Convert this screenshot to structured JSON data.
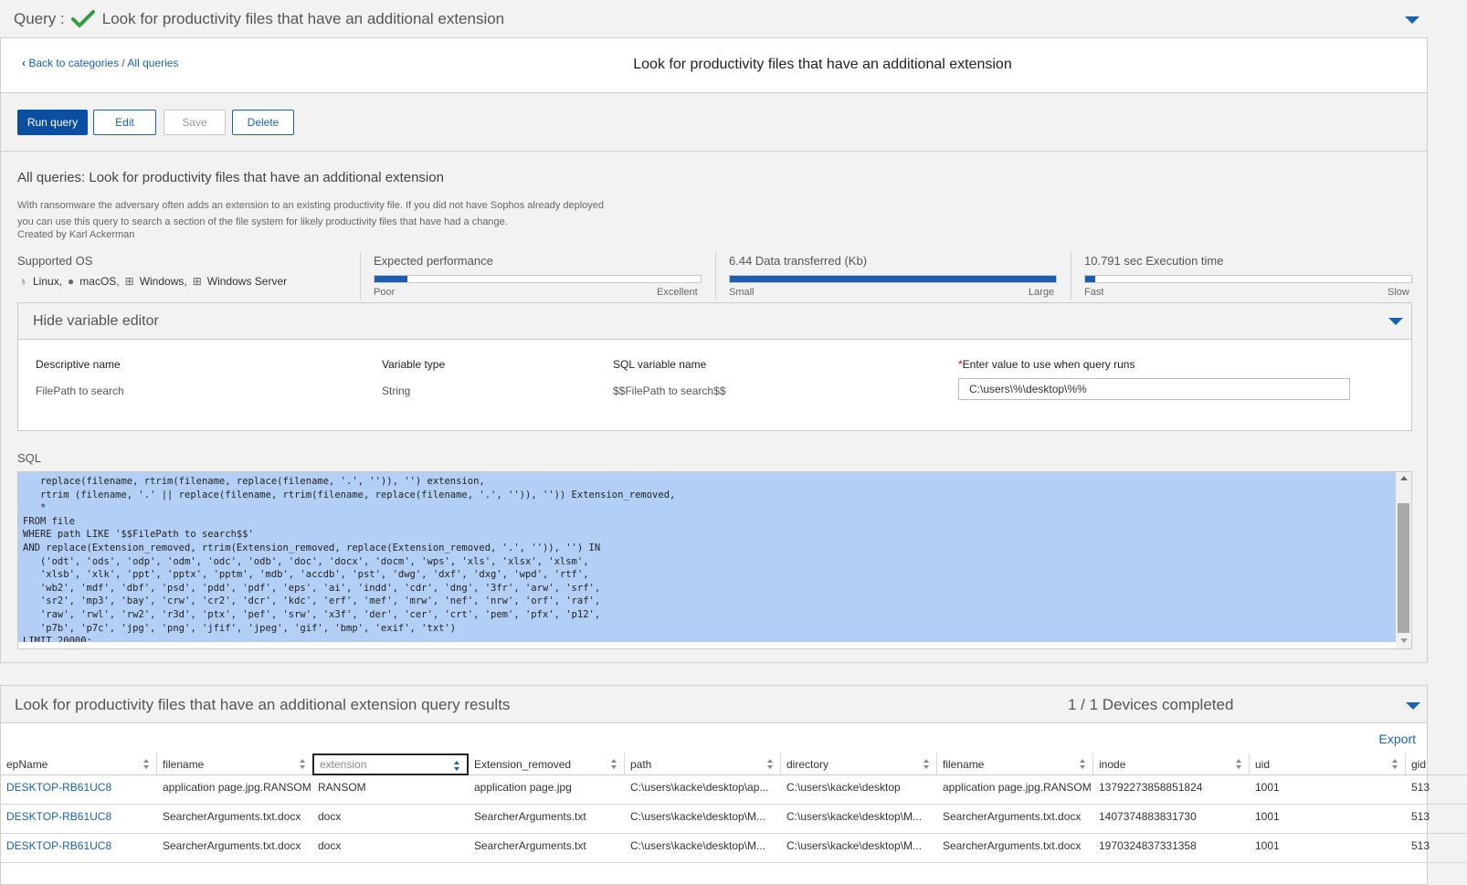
{
  "query_bar": {
    "prefix": "Query :",
    "title": "Look for productivity files that have an additional extension"
  },
  "breadcrumb": {
    "back": "Back to categories",
    "sep": " / ",
    "current": "All queries"
  },
  "header": {
    "title": "Look for productivity files that have an additional extension"
  },
  "toolbar": {
    "run": "Run query",
    "edit": "Edit",
    "save": "Save",
    "delete": "Delete"
  },
  "details": {
    "title": "All queries: Look for productivity files that have an additional extension",
    "description": "With ransomware the adversary often adds an extension to an existing productivity file. If you did not have Sophos already deployed you can use this query to search a section of the file system for likely productivity files that have had a change.",
    "author": "Created by Karl Ackerman"
  },
  "supported_os": {
    "label": "Supported OS",
    "items": [
      "Linux,",
      "macOS,",
      "Windows,",
      "Windows Server"
    ]
  },
  "metrics": {
    "performance": {
      "label": "Expected performance",
      "low": "Poor",
      "high": "Excellent",
      "fraction": 0.1
    },
    "data": {
      "label": "6.44 Data transferred (Kb)",
      "low": "Small",
      "high": "Large",
      "fraction": 1.0
    },
    "time": {
      "label": "10.791 sec Execution time",
      "low": "Fast",
      "high": "Slow",
      "fraction": 0.03
    }
  },
  "variable_editor": {
    "toggle": "Hide variable editor",
    "headers": {
      "name": "Descriptive name",
      "type": "Variable type",
      "sql": "SQL variable name",
      "value_req": "*",
      "value": "Enter value to use when query runs"
    },
    "row": {
      "name": "FilePath to search",
      "type": "String",
      "sql": "$$FilePath to search$$",
      "value": "C:\\users\\%\\desktop\\%%"
    }
  },
  "sql": {
    "label": "SQL",
    "lines": [
      "   replace(filename, rtrim(filename, replace(filename, '.', '')), '') extension,",
      "   rtrim (filename, '.' || replace(filename, rtrim(filename, replace(filename, '.', '')), '')) Extension_removed,",
      "   *",
      "FROM file",
      "WHERE path LIKE '$$FilePath to search$$'",
      "AND replace(Extension_removed, rtrim(Extension_removed, replace(Extension_removed, '.', '')), '') IN",
      "   ('odt', 'ods', 'odp', 'odm', 'odc', 'odb', 'doc', 'docx', 'docm', 'wps', 'xls', 'xlsx', 'xlsm',",
      "   'xlsb', 'xlk', 'ppt', 'pptx', 'pptm', 'mdb', 'accdb', 'pst', 'dwg', 'dxf', 'dxg', 'wpd', 'rtf',",
      "   'wb2', 'mdf', 'dbf', 'psd', 'pdd', 'pdf', 'eps', 'ai', 'indd', 'cdr', 'dng', '3fr', 'arw', 'srf',",
      "   'sr2', 'mp3', 'bay', 'crw', 'cr2', 'dcr', 'kdc', 'erf', 'mef', 'mrw', 'nef', 'nrw', 'orf', 'raf',",
      "   'raw', 'rwl', 'rw2', 'r3d', 'ptx', 'pef', 'srw', 'x3f', 'der', 'cer', 'crt', 'pem', 'pfx', 'p12',",
      "   'p7b', 'p7c', 'jpg', 'png', 'jfif', 'jpeg', 'gif', 'bmp', 'exif', 'txt')",
      "LIMIT 20000;"
    ]
  },
  "results": {
    "title": "Look for productivity files that have an additional extension query results",
    "status": "1 / 1 Devices completed",
    "export": "Export",
    "columns": [
      "epName",
      "filename",
      "extension",
      "Extension_removed",
      "path",
      "directory",
      "filename",
      "inode",
      "uid",
      "gid"
    ],
    "rows": [
      [
        "DESKTOP-RB61UC8",
        "application page.jpg.RANSOM",
        "RANSOM",
        "application page.jpg",
        "C:\\users\\kacke\\desktop\\ap...",
        "C:\\users\\kacke\\desktop",
        "application page.jpg.RANSOM",
        "13792273858851824",
        "1001",
        "513"
      ],
      [
        "DESKTOP-RB61UC8",
        "SearcherArguments.txt.docx",
        "docx",
        "SearcherArguments.txt",
        "C:\\users\\kacke\\desktop\\M...",
        "C:\\users\\kacke\\desktop\\M...",
        "SearcherArguments.txt.docx",
        "1407374883831730",
        "1001",
        "513"
      ],
      [
        "DESKTOP-RB61UC8",
        "SearcherArguments.txt.docx",
        "docx",
        "SearcherArguments.txt",
        "C:\\users\\kacke\\desktop\\M...",
        "C:\\users\\kacke\\desktop\\M...",
        "SearcherArguments.txt.docx",
        "1970324837331358",
        "1001",
        "513"
      ]
    ]
  },
  "colors": {
    "accent": "#1a62b3",
    "primary_button": "#0b4fa3",
    "success": "#2e9e3e",
    "selection": "#b3cff5"
  },
  "icons": {
    "status": "check-icon",
    "collapse": "chevron-down-icon",
    "back": "chevron-left-icon"
  }
}
